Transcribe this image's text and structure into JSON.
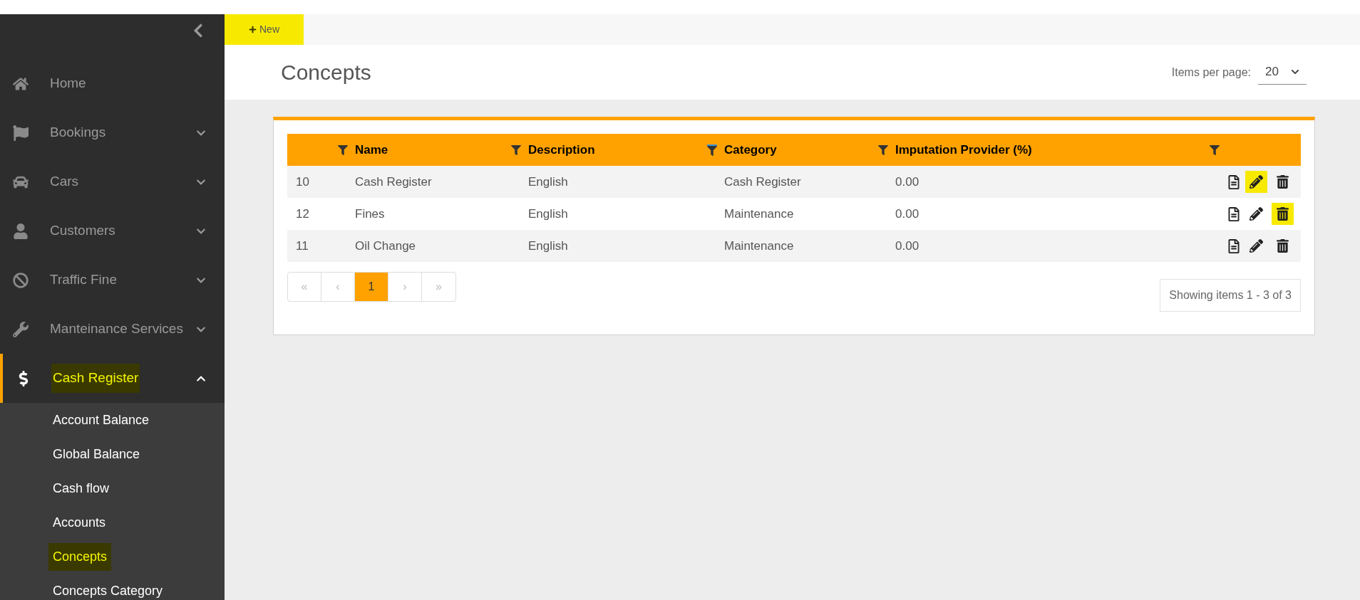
{
  "toolbar": {
    "new_button": {
      "label": "New",
      "highlighted": true
    }
  },
  "page": {
    "title": "Concepts",
    "items_per_page": {
      "label": "Items per page:",
      "value": "20"
    }
  },
  "sidebar": {
    "items": [
      {
        "label": "Home",
        "expandable": false,
        "expanded": false,
        "selected": false,
        "highlighted": false
      },
      {
        "label": "Bookings",
        "expandable": true,
        "expanded": false,
        "selected": false,
        "highlighted": false
      },
      {
        "label": "Cars",
        "expandable": true,
        "expanded": false,
        "selected": false,
        "highlighted": false
      },
      {
        "label": "Customers",
        "expandable": true,
        "expanded": false,
        "selected": false,
        "highlighted": false
      },
      {
        "label": "Traffic Fine",
        "expandable": true,
        "expanded": false,
        "selected": false,
        "highlighted": false
      },
      {
        "label": "Manteinance Services",
        "expandable": true,
        "expanded": false,
        "selected": false,
        "highlighted": false
      },
      {
        "label": "Cash Register",
        "expandable": true,
        "expanded": true,
        "selected": true,
        "highlighted": true,
        "children": [
          {
            "label": "Account Balance",
            "highlighted": false
          },
          {
            "label": "Global Balance",
            "highlighted": false
          },
          {
            "label": "Cash flow",
            "highlighted": false
          },
          {
            "label": "Accounts",
            "highlighted": false
          },
          {
            "label": "Concepts",
            "highlighted": true
          },
          {
            "label": "Concepts Category",
            "highlighted": false
          }
        ]
      }
    ]
  },
  "table": {
    "columns": [
      {
        "filtered": false
      },
      {
        "label": "Name",
        "filtered": false
      },
      {
        "label": "Description",
        "filtered": true
      },
      {
        "label": "Category",
        "filtered": false
      },
      {
        "label": "Imputation Provider (%)",
        "filtered": false
      }
    ],
    "rows": [
      {
        "cells": [
          "10",
          "Cash Register",
          "English",
          "Cash Register",
          "0.00"
        ],
        "edit_highlighted": true,
        "delete_highlighted": false
      },
      {
        "cells": [
          "12",
          "Fines",
          "English",
          "Maintenance",
          "0.00"
        ],
        "edit_highlighted": false,
        "delete_highlighted": true
      },
      {
        "cells": [
          "11",
          "Oil Change",
          "English",
          "Maintenance",
          "0.00"
        ],
        "edit_highlighted": false,
        "delete_highlighted": false
      }
    ]
  },
  "pagination": {
    "pages": [
      {
        "label": "«",
        "kind": "nav",
        "selected": false
      },
      {
        "label": "‹",
        "kind": "nav",
        "selected": false
      },
      {
        "label": "1",
        "kind": "page",
        "selected": true
      },
      {
        "label": "›",
        "kind": "nav",
        "selected": false
      },
      {
        "label": "»",
        "kind": "nav",
        "selected": false
      }
    ],
    "summary": "Showing items 1 - 3 of 3"
  }
}
